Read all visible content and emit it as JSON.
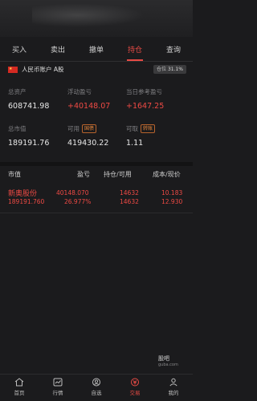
{
  "tabs": [
    {
      "label": "买入"
    },
    {
      "label": "卖出"
    },
    {
      "label": "撤单"
    },
    {
      "label": "持仓",
      "active": true
    },
    {
      "label": "查询"
    }
  ],
  "account": {
    "label": "人民币账户 A股",
    "flag_text": "★",
    "position_label": "仓位",
    "position_value": "31.1%"
  },
  "stats": {
    "total_assets": {
      "label": "总资产",
      "value": "608741.98"
    },
    "floating_pl": {
      "label": "浮动盈亏",
      "value": "+40148.07"
    },
    "today_ref_pl": {
      "label": "当日参考盈亏",
      "value": "+1647.25"
    },
    "market_value": {
      "label": "总市值",
      "value": "189191.76"
    },
    "available": {
      "label": "可用",
      "chip": "国债",
      "value": "419430.22"
    },
    "withdrawable": {
      "label": "可取",
      "chip": "转账",
      "value": "1.11"
    }
  },
  "table": {
    "headers": {
      "market_value": "市值",
      "pl": "盈亏",
      "position": "持仓/可用",
      "cost": "成本/现价"
    },
    "rows": [
      {
        "name": "新奥股份",
        "market_value": "189191.760",
        "pl": "40148.070",
        "pl_pct": "26.977%",
        "holding": "14632",
        "available": "14632",
        "cost": "10.183",
        "price": "12.930"
      }
    ]
  },
  "watermark": {
    "title": "股吧",
    "sub": "guba.com"
  },
  "bottom_nav": [
    {
      "label": "首页",
      "icon": "home-icon"
    },
    {
      "label": "行情",
      "icon": "chart-icon"
    },
    {
      "label": "自选",
      "icon": "watchlist-icon"
    },
    {
      "label": "交易",
      "icon": "trade-icon",
      "active": true
    },
    {
      "label": "我的",
      "icon": "user-icon"
    }
  ],
  "colors": {
    "accent": "#e84b45",
    "up": "#ef4a44",
    "background": "#1b1b1d"
  }
}
